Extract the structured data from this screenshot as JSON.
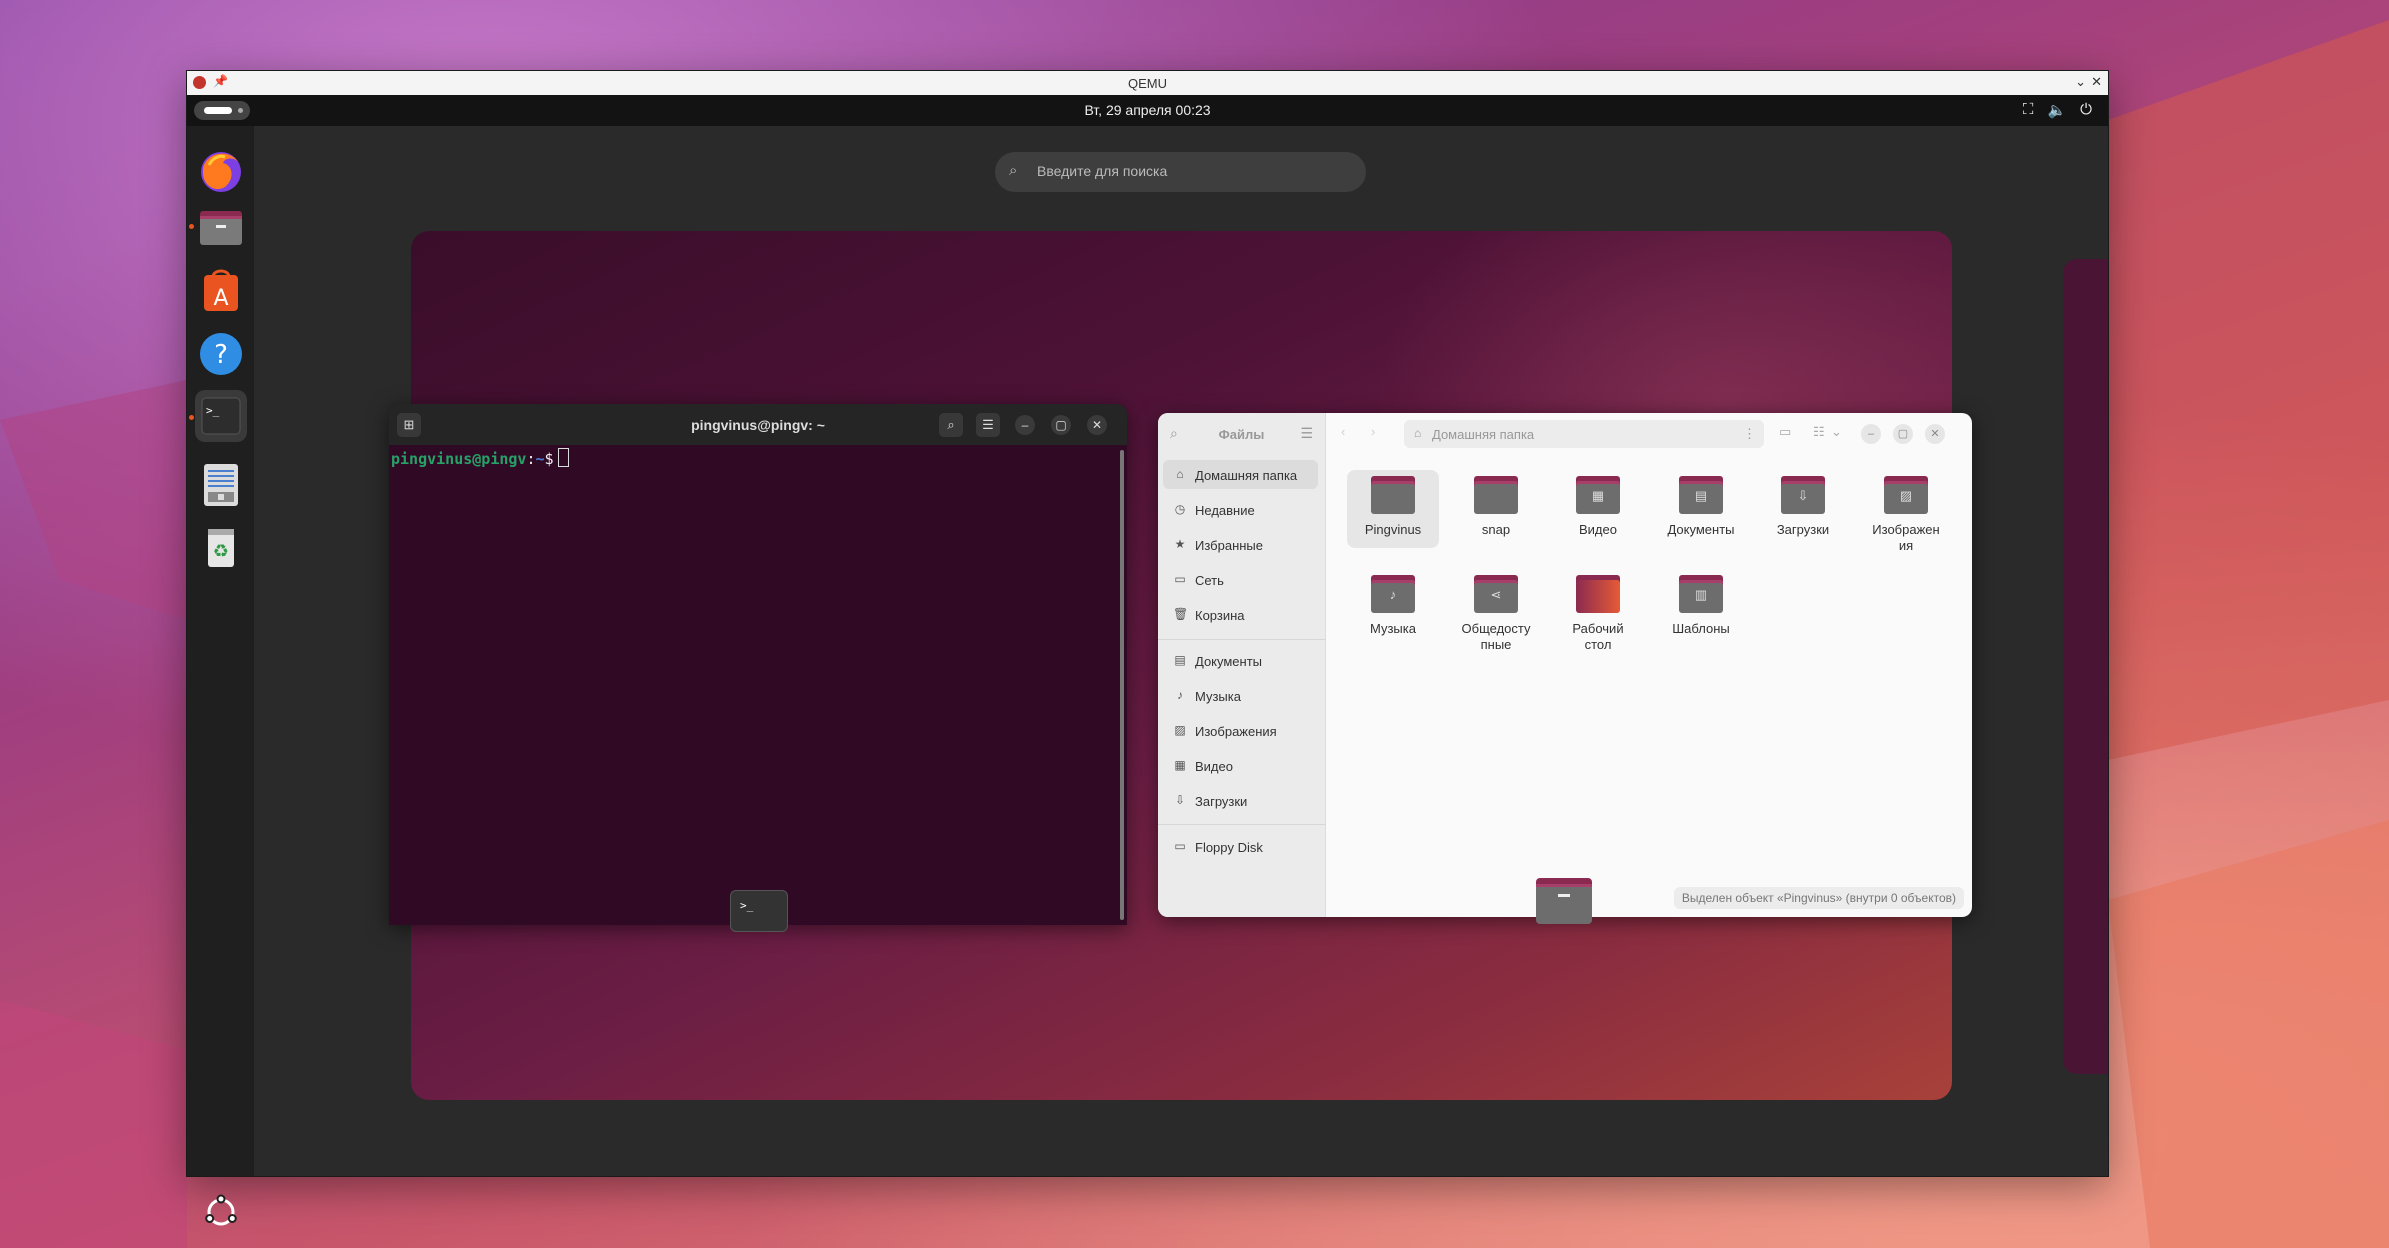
{
  "qemu": {
    "title": "QEMU",
    "min": "⌄",
    "close": "✕"
  },
  "topbar": {
    "clock": "Вт, 29 апреля  00:23",
    "tray": {
      "network": "⛶",
      "volume": "🔈",
      "power": "⏻"
    }
  },
  "dock": {
    "items": [
      "firefox",
      "files",
      "app-center",
      "help",
      "terminal",
      "text-editor",
      "trash"
    ]
  },
  "search": {
    "placeholder": "Введите для поиска",
    "icon": "⌕"
  },
  "terminal": {
    "title": "pingvinus@pingv: ~",
    "prompt_user": "pingvinus@pingv",
    "prompt_sep": ":",
    "prompt_path": "~",
    "prompt_char": "$",
    "buttons": {
      "new_tab": "⊞",
      "search": "⌕",
      "menu": "☰",
      "minimize": "–",
      "maximize": "▢",
      "close": "✕"
    }
  },
  "files": {
    "sidebar_title": "Файлы",
    "path": "Домашняя папка",
    "sidebar_items": [
      {
        "icon": "⌂",
        "label": "Домашняя папка"
      },
      {
        "icon": "◷",
        "label": "Недавние"
      },
      {
        "icon": "★",
        "label": "Избранные"
      },
      {
        "icon": "▭",
        "label": "Сеть"
      },
      {
        "icon": "🗑",
        "label": "Корзина"
      },
      {
        "icon": "▤",
        "label": "Документы"
      },
      {
        "icon": "♪",
        "label": "Музыка"
      },
      {
        "icon": "▨",
        "label": "Изображения"
      },
      {
        "icon": "▦",
        "label": "Видео"
      },
      {
        "icon": "⇩",
        "label": "Загрузки"
      },
      {
        "icon": "▭",
        "label": "Floppy Disk"
      }
    ],
    "grid": [
      {
        "label": "Pingvinus",
        "sym": ""
      },
      {
        "label": "snap",
        "sym": ""
      },
      {
        "label": "Видео",
        "sym": "▦"
      },
      {
        "label": "Документы",
        "sym": "▤"
      },
      {
        "label": "Загрузки",
        "sym": "⇩"
      },
      {
        "label": "Изображен\nия",
        "sym": "▨"
      },
      {
        "label": "Музыка",
        "sym": "♪"
      },
      {
        "label": "Общедосту\nпные",
        "sym": "⋖"
      },
      {
        "label": "Рабочий\nстол",
        "sym": ""
      },
      {
        "label": "Шаблоны",
        "sym": "▥"
      }
    ],
    "status": "Выделен объект «Pingvinus»  (внутри 0 объектов)"
  },
  "colors": {
    "accent": "#e95420",
    "terminal_bg": "#300a24",
    "folder": "#8b2a50"
  }
}
